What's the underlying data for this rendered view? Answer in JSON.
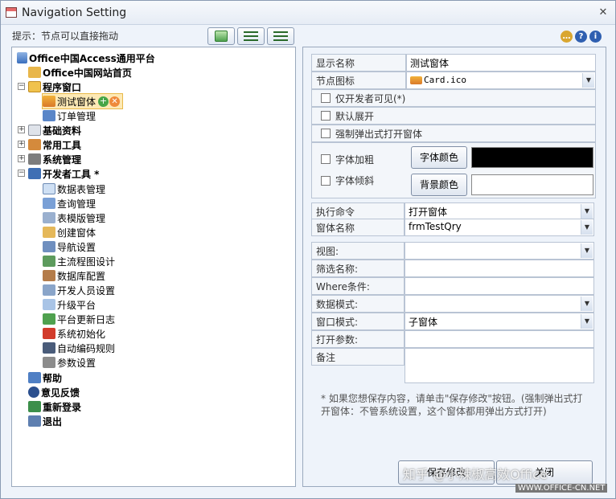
{
  "window": {
    "title": "Navigation Setting",
    "close": "✕"
  },
  "hint": "提示：节点可以直接拖动",
  "toolbar_icons": [
    "refresh-icon",
    "expand-all-icon",
    "collapse-all-icon"
  ],
  "help_icons": [
    "chat-icon",
    "help-icon",
    "info-icon"
  ],
  "tree": {
    "root": "Office中国Access通用平台",
    "home": "Office中国网站首页",
    "program_window": "程序窗口",
    "test_form": "测试窗体",
    "order_mgmt": "订单管理",
    "basic_data": "基础资料",
    "common_tools": "常用工具",
    "system_mgmt": "系统管理",
    "dev_tools": "开发者工具 *",
    "dev_items": [
      "数据表管理",
      "查询管理",
      "表模版管理",
      "创建窗体",
      "导航设置",
      "主流程图设计",
      "数据库配置",
      "开发人员设置",
      "升级平台",
      "平台更新日志",
      "系统初始化",
      "自动编码规则",
      "参数设置"
    ],
    "help": "帮助",
    "feedback": "意见反馈",
    "relogin": "重新登录",
    "exit": "退出"
  },
  "form": {
    "display_name_label": "显示名称",
    "display_name_value": "测试窗体",
    "node_icon_label": "节点图标",
    "node_icon_value": "Card.ico",
    "dev_only_label": "仅开发者可见(*)",
    "default_expand_label": "默认展开",
    "force_popup_label": "强制弹出式打开窗体",
    "bold_label": "字体加粗",
    "italic_label": "字体倾斜",
    "font_color_button": "字体颜色",
    "bg_color_button": "背景颜色",
    "font_color_value": "#000000",
    "bg_color_value": "#ffffff",
    "exec_cmd_label": "执行命令",
    "exec_cmd_value": "打开窗体",
    "form_name_label": "窗体名称",
    "form_name_value": "frmTestQry",
    "view_label": "视图:",
    "filter_label": "筛选名称:",
    "where_label": "Where条件:",
    "data_mode_label": "数据模式:",
    "window_mode_label": "窗口模式:",
    "window_mode_value": "子窗体",
    "open_args_label": "打开参数:",
    "remark_label": "备注"
  },
  "note": "* 如果您想保存内容，请单击\"保存修改\"按钮。(强制弹出式打开窗体：不管系统设置，这个窗体都用弹出方式打开)",
  "buttons": {
    "save": "保存修改",
    "cancel": "关闭"
  },
  "watermark": {
    "main": "知乎 @小辣椒高效Office",
    "site": "WWW.OFFICE-CN.NET"
  }
}
